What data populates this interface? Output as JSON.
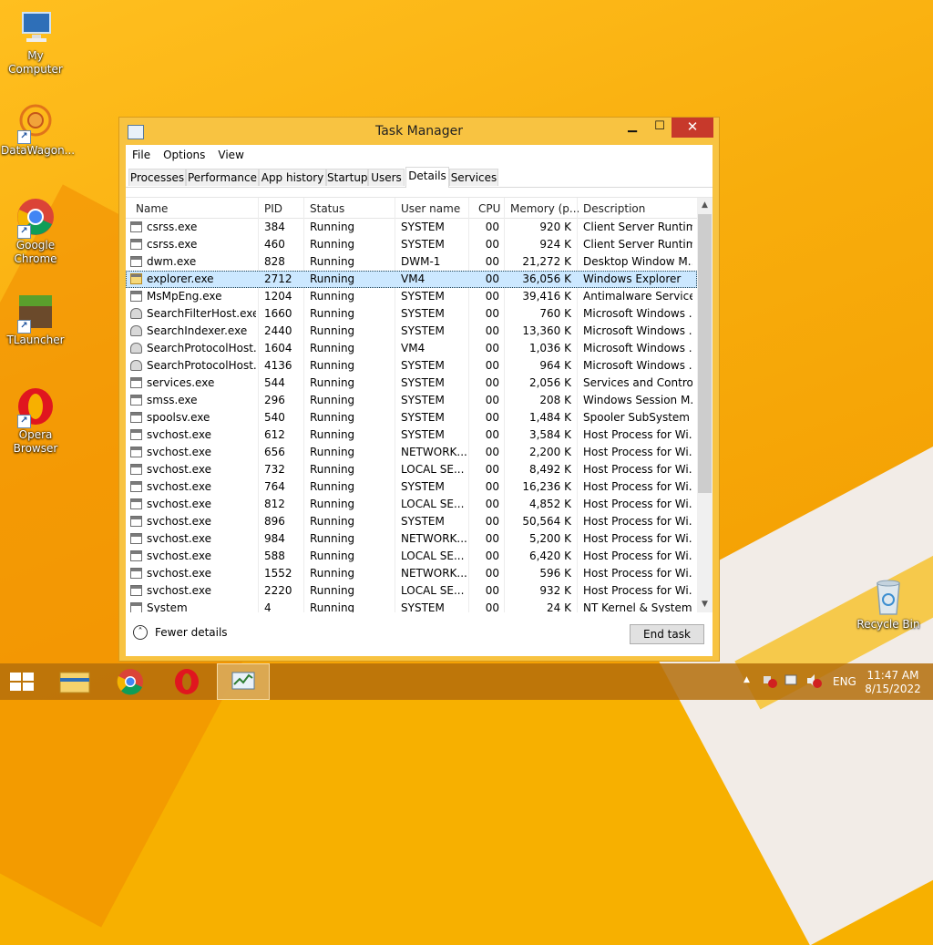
{
  "desktop": {
    "icons": [
      {
        "label": "My Computer"
      },
      {
        "label": "DataWagon..."
      },
      {
        "label": "Google Chrome"
      },
      {
        "label": "TLauncher"
      },
      {
        "label": "Opera Browser"
      },
      {
        "label": "Recycle Bin"
      }
    ]
  },
  "window": {
    "title": "Task Manager",
    "controls": {
      "minimize": "▁",
      "maximize": "☐",
      "close": "✕"
    },
    "menu": [
      "File",
      "Options",
      "View"
    ],
    "tabs": [
      "Processes",
      "Performance",
      "App history",
      "Startup",
      "Users",
      "Details",
      "Services"
    ],
    "active_tab": "Details",
    "columns": [
      "Name",
      "PID",
      "Status",
      "User name",
      "CPU",
      "Memory (p...",
      "Description"
    ],
    "rows": [
      {
        "name": "csrss.exe",
        "pid": "384",
        "status": "Running",
        "user": "SYSTEM",
        "cpu": "00",
        "mem": "920 K",
        "desc": "Client Server Runtim..."
      },
      {
        "name": "csrss.exe",
        "pid": "460",
        "status": "Running",
        "user": "SYSTEM",
        "cpu": "00",
        "mem": "924 K",
        "desc": "Client Server Runtim..."
      },
      {
        "name": "dwm.exe",
        "pid": "828",
        "status": "Running",
        "user": "DWM-1",
        "cpu": "00",
        "mem": "21,272 K",
        "desc": "Desktop Window M..."
      },
      {
        "name": "explorer.exe",
        "pid": "2712",
        "status": "Running",
        "user": "VM4",
        "cpu": "00",
        "mem": "36,056 K",
        "desc": "Windows Explorer"
      },
      {
        "name": "MsMpEng.exe",
        "pid": "1204",
        "status": "Running",
        "user": "SYSTEM",
        "cpu": "00",
        "mem": "39,416 K",
        "desc": "Antimalware Service..."
      },
      {
        "name": "SearchFilterHost.exe",
        "pid": "1660",
        "status": "Running",
        "user": "SYSTEM",
        "cpu": "00",
        "mem": "760 K",
        "desc": "Microsoft Windows ..."
      },
      {
        "name": "SearchIndexer.exe",
        "pid": "2440",
        "status": "Running",
        "user": "SYSTEM",
        "cpu": "00",
        "mem": "13,360 K",
        "desc": "Microsoft Windows ..."
      },
      {
        "name": "SearchProtocolHost....",
        "pid": "1604",
        "status": "Running",
        "user": "VM4",
        "cpu": "00",
        "mem": "1,036 K",
        "desc": "Microsoft Windows ..."
      },
      {
        "name": "SearchProtocolHost....",
        "pid": "4136",
        "status": "Running",
        "user": "SYSTEM",
        "cpu": "00",
        "mem": "964 K",
        "desc": "Microsoft Windows ..."
      },
      {
        "name": "services.exe",
        "pid": "544",
        "status": "Running",
        "user": "SYSTEM",
        "cpu": "00",
        "mem": "2,056 K",
        "desc": "Services and Control..."
      },
      {
        "name": "smss.exe",
        "pid": "296",
        "status": "Running",
        "user": "SYSTEM",
        "cpu": "00",
        "mem": "208 K",
        "desc": "Windows Session M..."
      },
      {
        "name": "spoolsv.exe",
        "pid": "540",
        "status": "Running",
        "user": "SYSTEM",
        "cpu": "00",
        "mem": "1,484 K",
        "desc": "Spooler SubSystem ..."
      },
      {
        "name": "svchost.exe",
        "pid": "612",
        "status": "Running",
        "user": "SYSTEM",
        "cpu": "00",
        "mem": "3,584 K",
        "desc": "Host Process for Wi..."
      },
      {
        "name": "svchost.exe",
        "pid": "656",
        "status": "Running",
        "user": "NETWORK...",
        "cpu": "00",
        "mem": "2,200 K",
        "desc": "Host Process for Wi..."
      },
      {
        "name": "svchost.exe",
        "pid": "732",
        "status": "Running",
        "user": "LOCAL SE...",
        "cpu": "00",
        "mem": "8,492 K",
        "desc": "Host Process for Wi..."
      },
      {
        "name": "svchost.exe",
        "pid": "764",
        "status": "Running",
        "user": "SYSTEM",
        "cpu": "00",
        "mem": "16,236 K",
        "desc": "Host Process for Wi..."
      },
      {
        "name": "svchost.exe",
        "pid": "812",
        "status": "Running",
        "user": "LOCAL SE...",
        "cpu": "00",
        "mem": "4,852 K",
        "desc": "Host Process for Wi..."
      },
      {
        "name": "svchost.exe",
        "pid": "896",
        "status": "Running",
        "user": "SYSTEM",
        "cpu": "00",
        "mem": "50,564 K",
        "desc": "Host Process for Wi..."
      },
      {
        "name": "svchost.exe",
        "pid": "984",
        "status": "Running",
        "user": "NETWORK...",
        "cpu": "00",
        "mem": "5,200 K",
        "desc": "Host Process for Wi..."
      },
      {
        "name": "svchost.exe",
        "pid": "588",
        "status": "Running",
        "user": "LOCAL SE...",
        "cpu": "00",
        "mem": "6,420 K",
        "desc": "Host Process for Wi..."
      },
      {
        "name": "svchost.exe",
        "pid": "1552",
        "status": "Running",
        "user": "NETWORK...",
        "cpu": "00",
        "mem": "596 K",
        "desc": "Host Process for Wi..."
      },
      {
        "name": "svchost.exe",
        "pid": "2220",
        "status": "Running",
        "user": "LOCAL SE...",
        "cpu": "00",
        "mem": "932 K",
        "desc": "Host Process for Wi..."
      },
      {
        "name": "System",
        "pid": "4",
        "status": "Running",
        "user": "SYSTEM",
        "cpu": "00",
        "mem": "24 K",
        "desc": "NT Kernel & System"
      }
    ],
    "selected_row": 3,
    "fewer_details": "Fewer details",
    "end_task": "End task"
  },
  "taskbar": {
    "language": "ENG",
    "time": "11:47 AM",
    "date": "8/15/2022"
  },
  "colors": {
    "accent": "#f8c341",
    "close": "#c7392b",
    "selection": "#cce8ff"
  }
}
